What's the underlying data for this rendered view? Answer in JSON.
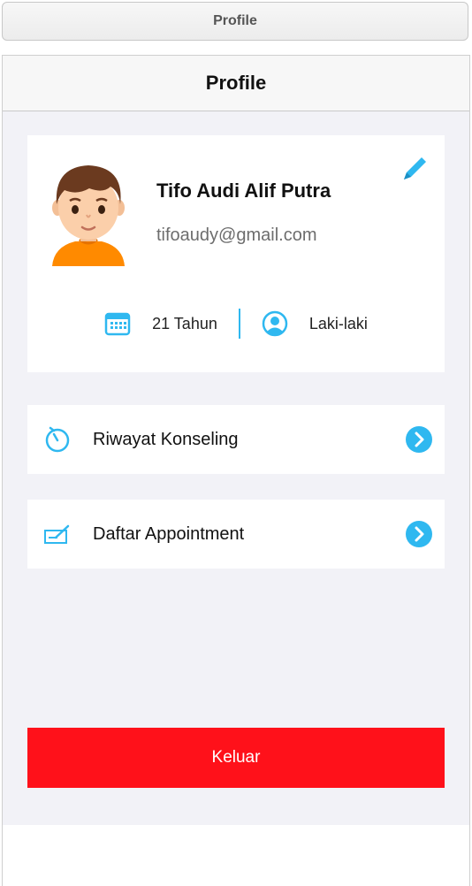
{
  "window": {
    "title": "Profile"
  },
  "nav": {
    "title": "Profile"
  },
  "profile": {
    "name": "Tifo Audi Alif Putra",
    "email": "tifoaudy@gmail.com",
    "age": "21 Tahun",
    "gender": "Laki-laki"
  },
  "menu": [
    {
      "label": "Riwayat Konseling",
      "icon": "timer-icon"
    },
    {
      "label": "Daftar Appointment",
      "icon": "appointment-list-icon"
    }
  ],
  "logout": {
    "label": "Keluar"
  },
  "colors": {
    "accent": "#2fb8f0",
    "danger": "#ff111a",
    "background": "#f2f2f7"
  }
}
